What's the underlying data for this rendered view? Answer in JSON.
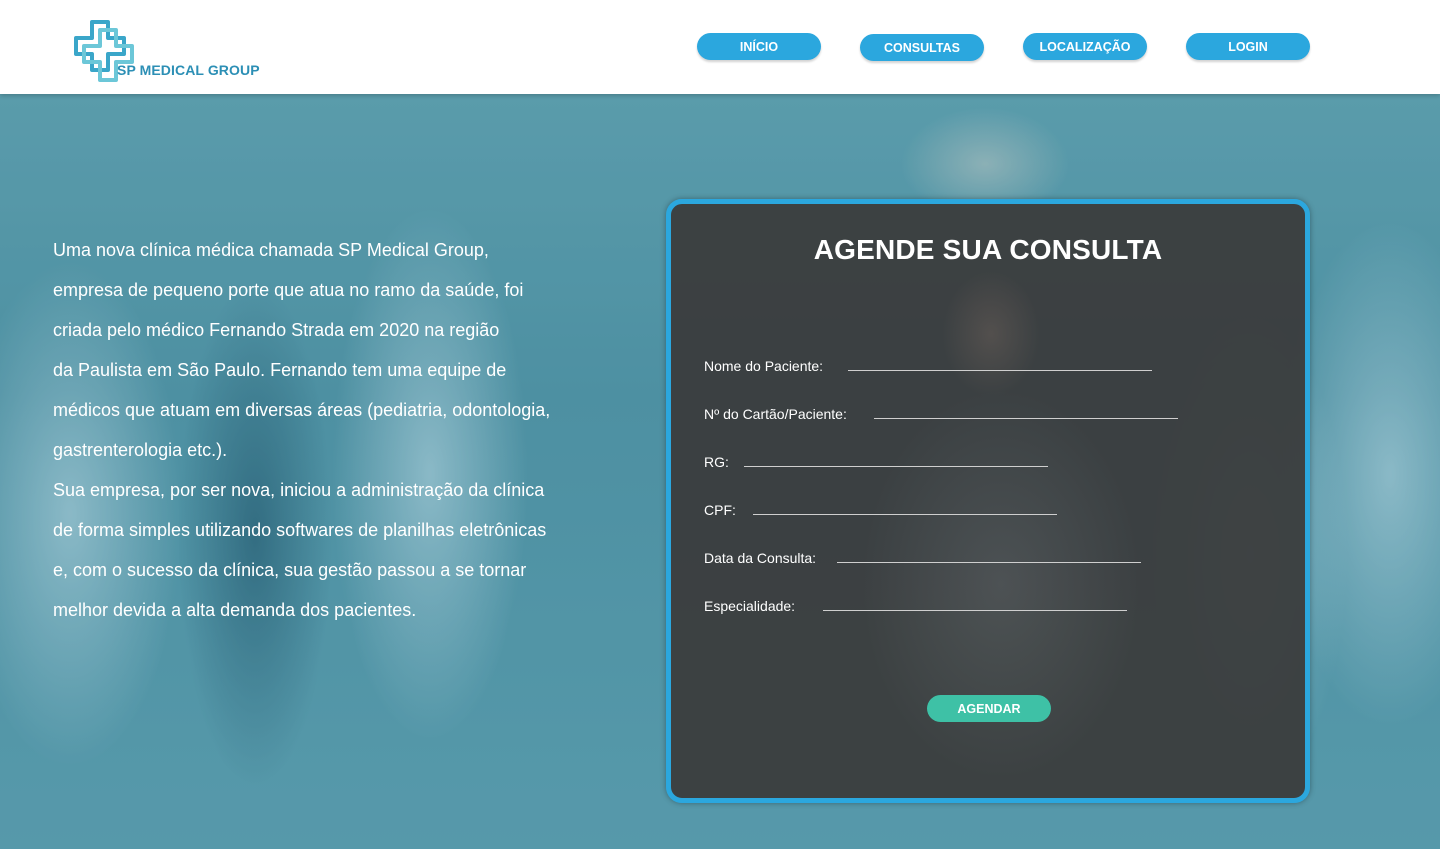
{
  "header": {
    "logo_text": "SP MEDICAL GROUP",
    "nav": [
      {
        "label": "INÍCIO"
      },
      {
        "label": "CONSULTAS"
      },
      {
        "label": "LOCALIZAÇÃO"
      },
      {
        "label": "LOGIN"
      }
    ]
  },
  "intro": {
    "lines": [
      "Uma nova clínica médica chamada SP Medical Group,",
      "empresa de pequeno porte que atua no ramo da saúde, foi",
      "criada pelo médico Fernando Strada em 2020 na região",
      "da Paulista em São Paulo. Fernando tem uma equipe de",
      "médicos que atuam em diversas áreas (pediatria, odontologia,",
      "gastrenterologia etc.).",
      "Sua empresa, por ser nova, iniciou a administração da clínica",
      "de forma simples utilizando softwares de planilhas eletrônicas",
      "e, com o sucesso da clínica, sua gestão passou a se tornar",
      "melhor devida a alta demanda dos pacientes."
    ]
  },
  "form": {
    "title": "AGENDE SUA CONSULTA",
    "fields": [
      {
        "label": "Nome do Paciente:",
        "value": ""
      },
      {
        "label": "Nº do Cartão/Paciente:",
        "value": ""
      },
      {
        "label": "RG:",
        "value": ""
      },
      {
        "label": "CPF:",
        "value": ""
      },
      {
        "label": "Data da Consulta:",
        "value": ""
      },
      {
        "label": "Especialidade:",
        "value": ""
      }
    ],
    "submit_label": "AGENDAR"
  },
  "colors": {
    "accent": "#2ba7de",
    "submit": "#3ec1a6",
    "logo": "#2c8fb5",
    "card_bg": "#3a3a3a"
  }
}
